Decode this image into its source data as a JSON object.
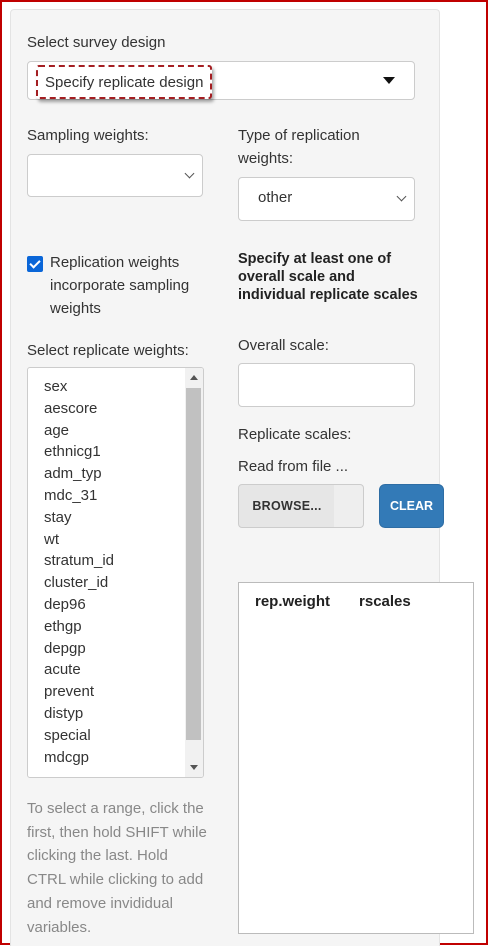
{
  "survey_design": {
    "label": "Select survey design",
    "selected": "Specify replicate design"
  },
  "sampling_weights": {
    "label": "Sampling weights:",
    "value": ""
  },
  "replication_type": {
    "label": "Type of replication weights:",
    "selected": "other"
  },
  "incorporate_checkbox": {
    "checked": true,
    "label": "Replication weights incorporate sampling weights"
  },
  "replicate_weights": {
    "label": "Select replicate weights:",
    "items": [
      "sex",
      "aescore",
      "age",
      "ethnicg1",
      "adm_typ",
      "mdc_31",
      "stay",
      "wt",
      "stratum_id",
      "cluster_id",
      "dep96",
      "ethgp",
      "depgp",
      "acute",
      "prevent",
      "distyp",
      "special",
      "mdcgp"
    ]
  },
  "help_text": "To select a range, click the first, then hold SHIFT while clicking the last. Hold CTRL while clicking to add and remove invididual variables.",
  "scales": {
    "heading": "Specify at least one of overall scale and individual replicate scales",
    "overall_label": "Overall scale:",
    "overall_value": "",
    "replicate_label": "Replicate scales:",
    "read_label": "Read from file ...",
    "browse_label": "BROWSE...",
    "clear_label": "CLEAR"
  },
  "table": {
    "columns": [
      "rep.weight",
      "rscales"
    ]
  },
  "colors": {
    "accent": "#337ab7",
    "checkbox": "#0a66d8",
    "highlight_border": "#a41e22",
    "frame": "#c00000"
  }
}
